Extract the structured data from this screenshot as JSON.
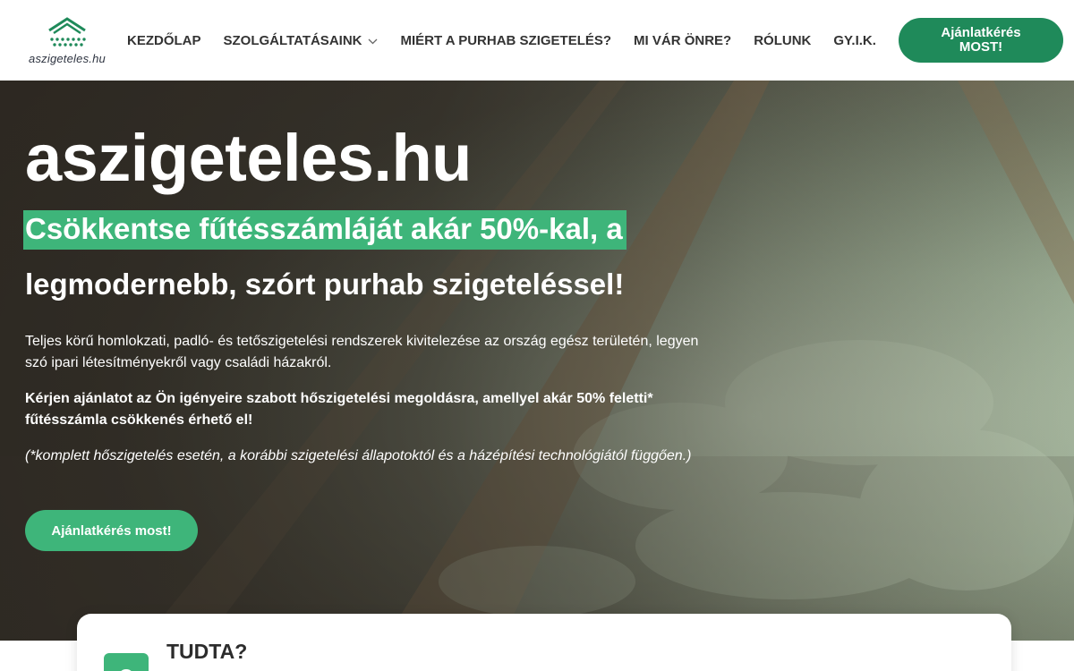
{
  "brand": {
    "logo_text": "aszigeteles.hu",
    "accent_color": "#1f8a5a",
    "highlight_color": "#3eb57a"
  },
  "nav": {
    "items": [
      {
        "label": "KEZDŐLAP"
      },
      {
        "label": "SZOLGÁLTATÁSAINK"
      },
      {
        "label": "MIÉRT A PURHAB SZIGETELÉS?"
      },
      {
        "label": "MI VÁR ÖNRE?"
      },
      {
        "label": "RÓLUNK"
      },
      {
        "label": "GY.I.K."
      }
    ],
    "cta_label": "Ajánlatkérés MOST!"
  },
  "hero": {
    "title": "aszigeteles.hu",
    "subtitle_highlight": "Csökkentse fűtésszámláját akár 50%-kal, a",
    "subtitle_rest": "legmodernebb, szórt purhab szigeteléssel!",
    "paragraph1": "Teljes körű homlokzati, padló- és tetőszigetelési rendszerek kivitelezése az ország egész területén, legyen szó ipari létesítményekről vagy családi házakról.",
    "paragraph2": "Kérjen ajánlatot az Ön igényeire szabott hőszigetelési megoldásra, amellyel akár 50% feletti* fűtésszámla csökkenés érhető el!",
    "paragraph3": "(*komplett hőszigetelés esetén, a korábbi szigetelési állapotoktól és a házépítési technológiától függően.)",
    "button_label": "Ajánlatkérés most!"
  },
  "info_card": {
    "title": "TUDTA?",
    "icon": "info-icon"
  }
}
